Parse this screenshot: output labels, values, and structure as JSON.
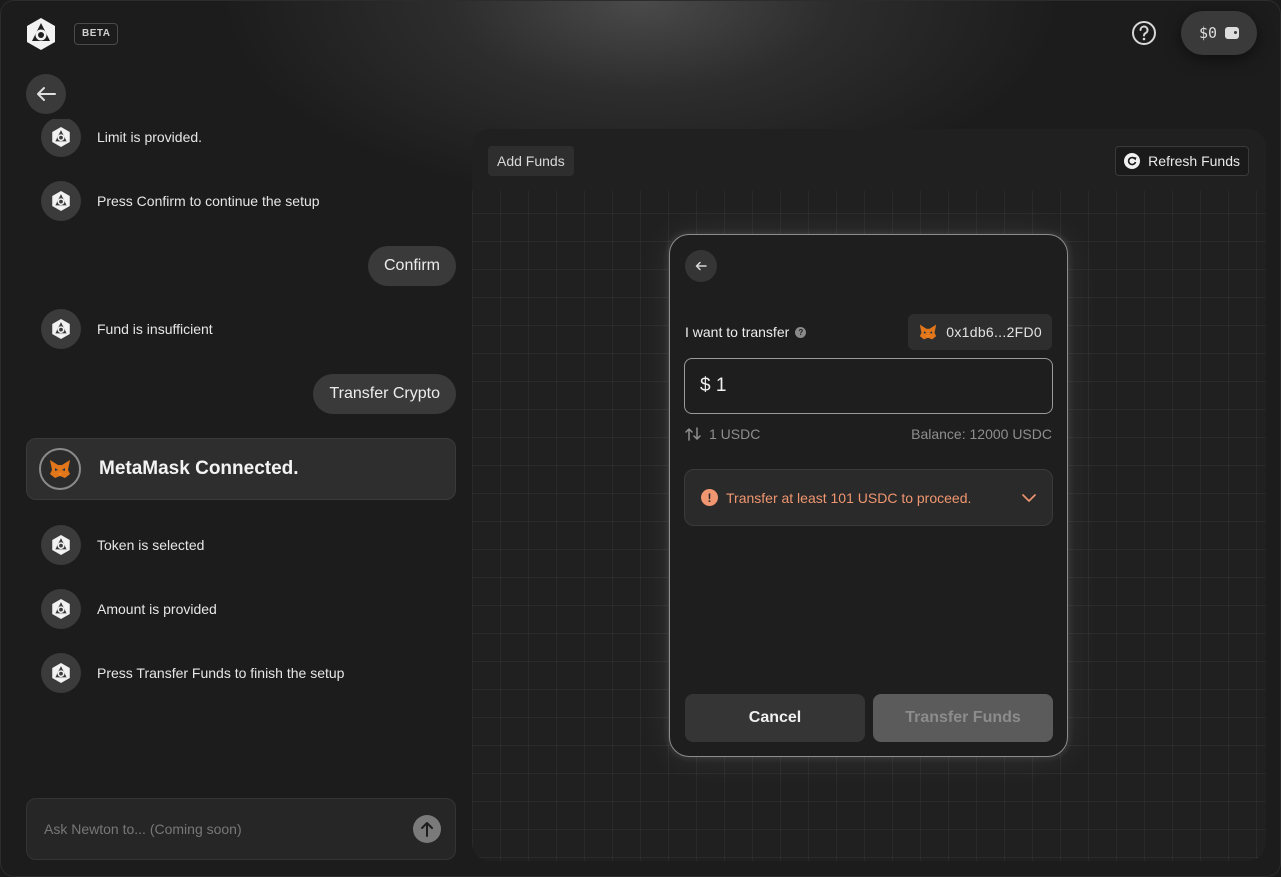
{
  "header": {
    "beta_label": "BETA",
    "wallet_balance": "$0"
  },
  "chat": {
    "messages": [
      {
        "from": "bot",
        "text": "Limit is provided."
      },
      {
        "from": "bot",
        "text": "Press Confirm to continue the setup"
      },
      {
        "from": "user",
        "text": "Confirm"
      },
      {
        "from": "bot",
        "text": "Fund is insufficient"
      },
      {
        "from": "user",
        "text": "Transfer Crypto"
      },
      {
        "from": "card",
        "text": "MetaMask Connected."
      },
      {
        "from": "bot",
        "text": "Token is selected"
      },
      {
        "from": "bot",
        "text": "Amount is provided"
      },
      {
        "from": "bot",
        "text": "Press Transfer Funds to finish the setup"
      }
    ],
    "input_placeholder": "Ask Newton to... (Coming soon)"
  },
  "workspace": {
    "add_funds_label": "Add Funds",
    "refresh_label": "Refresh Funds"
  },
  "modal": {
    "transfer_label": "I want to transfer",
    "wallet_address": "0x1db6...2FD0",
    "amount_value": "$ 1",
    "converted": "1 USDC",
    "balance": "Balance: 12000 USDC",
    "warning": "Transfer at least 101 USDC to proceed.",
    "cancel_label": "Cancel",
    "transfer_button_label": "Transfer Funds"
  },
  "colors": {
    "warning": "#f09670",
    "metamask_orange": "#e2761b"
  }
}
